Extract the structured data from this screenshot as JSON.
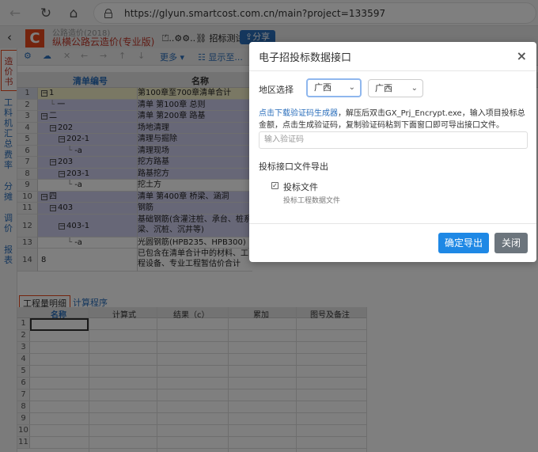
{
  "browser": {
    "url": "https://glyun.smartcost.com.cn/main?project=133597"
  },
  "app": {
    "title_small": "公路造价(2018)",
    "title_main": "纵横公路云造价(专业版)",
    "project_name": "⏍..⚙⚙..⛓ 招标测试",
    "share_label": "分享"
  },
  "sidebar": {
    "items": [
      "造价书",
      "工料机汇总",
      "费率",
      "分摊",
      "调价",
      "报表"
    ]
  },
  "toolbar": {
    "more": "更多",
    "show": "显示至..."
  },
  "grid": {
    "headers": {
      "code": "清单编号",
      "name": "名称"
    },
    "rows": [
      {
        "num": "1",
        "code": "1",
        "name": "第100章至700章清单合计",
        "indent": 0,
        "tog": "−",
        "style": "sel"
      },
      {
        "num": "2",
        "code": "一",
        "name": "清单 第100章 总则",
        "indent": 1,
        "tog": "",
        "style": "blue"
      },
      {
        "num": "3",
        "code": "二",
        "name": "清单 第200章 路基",
        "indent": 0,
        "tog": "−",
        "style": "blue"
      },
      {
        "num": "4",
        "code": "202",
        "name": "场地清理",
        "indent": 1,
        "tog": "−",
        "style": "blue"
      },
      {
        "num": "5",
        "code": "202-1",
        "name": "清理与掘除",
        "indent": 2,
        "tog": "−",
        "style": "blue"
      },
      {
        "num": "6",
        "code": "-a",
        "name": "清理现场",
        "indent": 3,
        "tog": "",
        "style": "blue"
      },
      {
        "num": "7",
        "code": "203",
        "name": "挖方路基",
        "indent": 1,
        "tog": "−",
        "style": "blue"
      },
      {
        "num": "8",
        "code": "203-1",
        "name": "路基挖方",
        "indent": 2,
        "tog": "−",
        "style": "blue"
      },
      {
        "num": "9",
        "code": "-a",
        "name": "挖土方",
        "indent": 3,
        "tog": "",
        "style": "white"
      },
      {
        "num": "10",
        "code": "四",
        "name": "清单 第400章 桥梁、涵洞",
        "indent": 0,
        "tog": "−",
        "style": "blue"
      },
      {
        "num": "11",
        "code": "403",
        "name": "钢筋",
        "indent": 1,
        "tog": "−",
        "style": "blue"
      },
      {
        "num": "12",
        "code": "403-1",
        "name": "基础钢筋(含灌注桩、承台、桩系梁、沉桩、沉井等)",
        "indent": 2,
        "tog": "−",
        "style": "blue"
      },
      {
        "num": "13",
        "code": "-a",
        "name": "光圆钢筋(HPB235、HPB300)",
        "indent": 3,
        "tog": "",
        "style": "white"
      },
      {
        "num": "14",
        "code": "8",
        "name": "已包含在清单合计中的材料、工程设备、专业工程暂估价合计",
        "indent": 0,
        "tog": "",
        "style": "white"
      }
    ]
  },
  "bottom": {
    "tabs": [
      "工程量明细",
      "计算程序"
    ],
    "headers": [
      "名称",
      "计算式",
      "结果（c）",
      "累加",
      "图号及备注"
    ],
    "rows": [
      "1",
      "2",
      "3",
      "4",
      "5",
      "6",
      "7",
      "8",
      "9",
      "10",
      "11"
    ]
  },
  "modal": {
    "title": "电子招投标数据接口",
    "region_label": "地区选择",
    "region1": "广西",
    "region2": "广西",
    "desc_link": "点击下载验证码生成器",
    "desc_text": "，解压后双击GX_Prj_Encrypt.exe，输入项目投标总金额，点击生成验证码，复制验证码粘到下面窗口即可导出接口文件。",
    "input_placeholder": "输入验证码",
    "export_section": "投标接口文件导出",
    "checkbox_label": "投标文件",
    "checkbox_hint": "投标工程数据文件",
    "ok_label": "确定导出",
    "close_label": "关闭"
  }
}
